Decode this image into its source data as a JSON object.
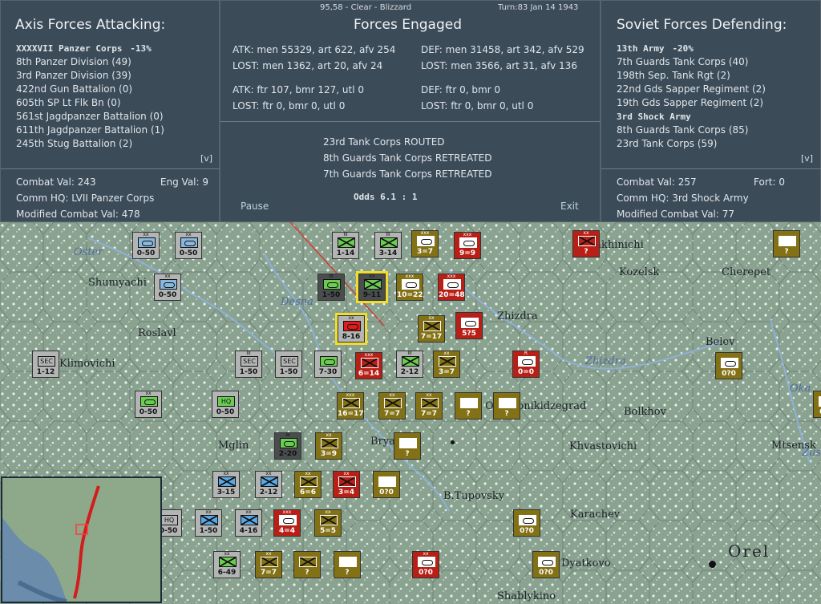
{
  "info_bar": {
    "hex": "95,58 - Clear - Blizzard",
    "turn": "Turn:83 Jan 14 1943"
  },
  "axis": {
    "title": "Axis Forces Attacking:",
    "corps": "XXXXVII Panzer Corps",
    "corps_mod": "-13%",
    "units": [
      "8th Panzer Division (49)",
      "3rd Panzer Division (39)",
      "422nd Gun Battalion (0)",
      "605th SP Lt Flk Bn (0)",
      "561st Jagdpanzer Battalion (0)",
      "611th Jagdpanzer Battalion (1)",
      "245th Stug Battalion (2)"
    ],
    "expand": "[v]",
    "combat_val_label": "Combat Val: 243",
    "eng_val_label": "Eng Val: 9",
    "comm_hq": "Comm HQ: LVII Panzer Corps",
    "modified_combat_val": "Modified Combat Val: 478"
  },
  "center": {
    "title": "Forces Engaged",
    "atk_line1": "ATK: men 55329, art 622, afv 254",
    "atk_lost1": "LOST: men 1362, art 20, afv 24",
    "def_line1": "DEF: men 31458, art 342, afv 529",
    "def_lost1": "LOST: men 3566, art 31, afv 136",
    "atk_line2": "ATK: ftr 107, bmr 127, utl 0",
    "atk_lost2": "LOST: ftr 0, bmr 0, utl 0",
    "def_line2": "DEF: ftr 0, bmr 0",
    "def_lost2": "LOST: ftr 0, bmr 0, utl 0",
    "results": [
      "23rd Tank Corps ROUTED",
      "8th Guards Tank Corps RETREATED",
      "7th Guards Tank Corps RETREATED"
    ],
    "odds": "Odds 6.1 : 1",
    "pause_label": "Pause",
    "exit_label": "Exit"
  },
  "soviet": {
    "title": "Soviet Forces Defending:",
    "army1": "13th Army",
    "army1_mod": "-20%",
    "army1_units": [
      "7th Guards Tank Corps (40)",
      "198th Sep. Tank Rgt (2)",
      "22nd Gds Sapper Regiment (2)",
      "19th Gds Sapper Regiment (2)"
    ],
    "army2": "3rd Shock Army",
    "army2_units": [
      "8th Guards Tank Corps (85)",
      "23rd Tank Corps (59)"
    ],
    "expand": "[v]",
    "combat_val_label": "Combat Val: 257",
    "fort_label": "Fort: 0",
    "comm_hq": "Comm HQ: 3rd Shock Army",
    "modified_combat_val": "Modified Combat Val: 77"
  },
  "map": {
    "towns": [
      "Lukhinichi",
      "Kozelsk",
      "Cherepet",
      "Shumyachi",
      "Roslavl",
      "Zhizdra",
      "Belev",
      "Klimovichi",
      "Ordzhonikidzegrad",
      "Bolkhov",
      "Mglin",
      "Khvastovichi",
      "Mtsensk",
      "Bryansk",
      "B.Tupovsky",
      "Karachev",
      "Orel",
      "Shablykino",
      "Dyatkovo"
    ],
    "rivers": [
      "Oster",
      "Desna",
      "Zhizdra",
      "Oka",
      "Zusha"
    ],
    "counters": [
      {
        "id": "u1",
        "color": "grey",
        "size": "xx",
        "sym": "armor-lblue",
        "str": "0-50"
      },
      {
        "id": "u2",
        "color": "grey",
        "size": "xx",
        "sym": "armor-lblue",
        "str": "0-50"
      },
      {
        "id": "u3",
        "color": "grey",
        "size": "xx",
        "sym": "armor-lblue",
        "str": "0-50"
      },
      {
        "id": "u4",
        "color": "grey",
        "size": "III",
        "sym": "inf-green",
        "str": "1-14"
      },
      {
        "id": "u5",
        "color": "grey",
        "size": "III",
        "sym": "inf-green",
        "str": "3-14"
      },
      {
        "id": "u6",
        "color": "olive",
        "size": "xxx",
        "sym": "armor",
        "str": "3=7"
      },
      {
        "id": "u7",
        "color": "red",
        "size": "xxx",
        "sym": "armor",
        "str": "9=9"
      },
      {
        "id": "u8",
        "color": "red",
        "size": "xx",
        "sym": "inf",
        "str": "?"
      },
      {
        "id": "u9",
        "color": "olive",
        "size": "",
        "sym": "blank",
        "str": "?"
      },
      {
        "id": "u10",
        "color": "black",
        "size": "III",
        "sym": "armor-green",
        "str": "1-50"
      },
      {
        "id": "u11",
        "color": "black",
        "size": "xx",
        "sym": "inf-green",
        "str": "9-11"
      },
      {
        "id": "u12",
        "color": "olive",
        "size": "xxx",
        "sym": "armor",
        "str": "10=22"
      },
      {
        "id": "u13",
        "color": "red",
        "size": "xxx",
        "sym": "armor",
        "str": "20=48"
      },
      {
        "id": "u14",
        "color": "grey",
        "size": "xx",
        "sym": "redarm",
        "str": "8-16"
      },
      {
        "id": "u15",
        "color": "olive",
        "size": "xx",
        "sym": "inf",
        "str": "7=17"
      },
      {
        "id": "u16",
        "color": "red",
        "size": "",
        "sym": "armor",
        "str": "5?5"
      },
      {
        "id": "u17",
        "color": "red",
        "size": "R",
        "sym": "armor",
        "str": "0=0"
      },
      {
        "id": "u18",
        "color": "olive",
        "size": "",
        "sym": "armor",
        "str": "0?0"
      },
      {
        "id": "u19",
        "color": "grey",
        "size": "",
        "sym": "SEC",
        "str": "1-12"
      },
      {
        "id": "u20",
        "color": "grey",
        "size": "III",
        "sym": "SEC",
        "str": "1-50"
      },
      {
        "id": "u21",
        "color": "grey",
        "size": "",
        "sym": "SEC",
        "str": "1-50"
      },
      {
        "id": "u22",
        "color": "grey",
        "size": "",
        "sym": "armor-green",
        "str": "7-30"
      },
      {
        "id": "u23",
        "color": "red",
        "size": "xxx",
        "sym": "inf",
        "str": "6=14"
      },
      {
        "id": "u24",
        "color": "grey",
        "size": "III",
        "sym": "inf-green",
        "str": "2-12"
      },
      {
        "id": "u25",
        "color": "olive",
        "size": "xx",
        "sym": "inf",
        "str": "3=7"
      },
      {
        "id": "u26",
        "color": "grey",
        "size": "xx",
        "sym": "armor-green",
        "str": "0-50"
      },
      {
        "id": "u27",
        "color": "grey",
        "size": "",
        "sym": "HQ",
        "str": "0-50"
      },
      {
        "id": "u28",
        "color": "olive",
        "size": "xxx",
        "sym": "inf",
        "str": "16=17"
      },
      {
        "id": "u29",
        "color": "olive",
        "size": "xx",
        "sym": "inf",
        "str": "7=7"
      },
      {
        "id": "u30",
        "color": "olive",
        "size": "xx",
        "sym": "inf",
        "str": "7=7"
      },
      {
        "id": "u31",
        "color": "olive",
        "size": "",
        "sym": "blank",
        "str": "?"
      },
      {
        "id": "u32",
        "color": "olive",
        "size": "",
        "sym": "blank",
        "str": "?"
      },
      {
        "id": "u33",
        "color": "black",
        "size": "III",
        "sym": "armor-green",
        "str": "2-20"
      },
      {
        "id": "u34",
        "color": "olive",
        "size": "xx",
        "sym": "inf",
        "str": "3=9"
      },
      {
        "id": "u35",
        "color": "olive",
        "size": "",
        "sym": "blank",
        "str": "?"
      },
      {
        "id": "u36",
        "color": "grey",
        "size": "xx",
        "sym": "inf-blue",
        "str": "3-15"
      },
      {
        "id": "u37",
        "color": "grey",
        "size": "xx",
        "sym": "inf-blue",
        "str": "2-12"
      },
      {
        "id": "u38",
        "color": "olive",
        "size": "xx",
        "sym": "inf",
        "str": "6=6"
      },
      {
        "id": "u39",
        "color": "red",
        "size": "xx",
        "sym": "inf",
        "str": "3=4"
      },
      {
        "id": "u40",
        "color": "olive",
        "size": "",
        "sym": "arty",
        "str": "0?0"
      },
      {
        "id": "u41",
        "color": "grey",
        "size": "",
        "sym": "HQ",
        "str": "0-50"
      },
      {
        "id": "u42",
        "color": "grey",
        "size": "xx",
        "sym": "inf-blue",
        "str": "1-50"
      },
      {
        "id": "u43",
        "color": "grey",
        "size": "xx",
        "sym": "inf-blue",
        "str": "4-16"
      },
      {
        "id": "u44",
        "color": "red",
        "size": "xxx",
        "sym": "armor",
        "str": "4=4"
      },
      {
        "id": "u45",
        "color": "olive",
        "size": "xx",
        "sym": "inf",
        "str": "5=5"
      },
      {
        "id": "u46",
        "color": "olive",
        "size": "",
        "sym": "armor",
        "str": "0?0"
      },
      {
        "id": "u47",
        "color": "grey",
        "size": "xx",
        "sym": "inf-green",
        "str": "6-49"
      },
      {
        "id": "u48",
        "color": "olive",
        "size": "xx",
        "sym": "inf",
        "str": "7=7"
      },
      {
        "id": "u49",
        "color": "olive",
        "size": "",
        "sym": "inf",
        "str": "?"
      },
      {
        "id": "u50",
        "color": "olive",
        "size": "",
        "sym": "blank",
        "str": "?"
      },
      {
        "id": "u51",
        "color": "red",
        "size": "xx",
        "sym": "armor",
        "str": "0?0"
      },
      {
        "id": "u52",
        "color": "olive",
        "size": "",
        "sym": "armor",
        "str": "0?0"
      },
      {
        "id": "u53",
        "color": "olive",
        "size": "",
        "sym": "armor",
        "str": "0?0"
      }
    ]
  }
}
